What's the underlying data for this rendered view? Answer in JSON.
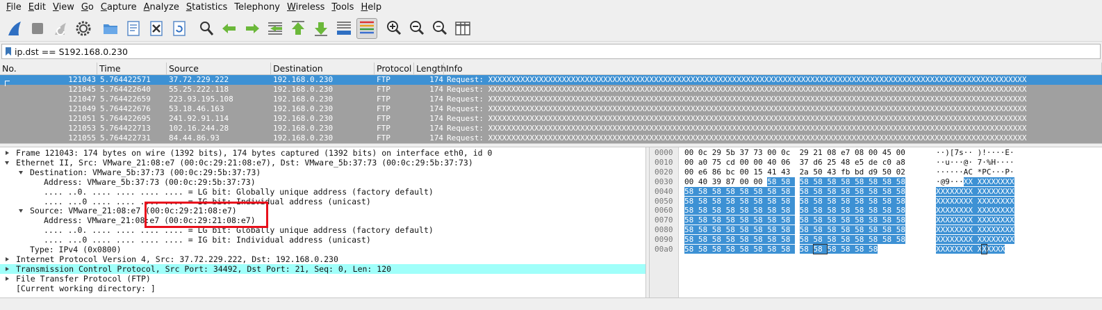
{
  "menu": [
    "File",
    "Edit",
    "View",
    "Go",
    "Capture",
    "Analyze",
    "Statistics",
    "Telephony",
    "Wireless",
    "Tools",
    "Help"
  ],
  "menu_underline": [
    "F",
    "E",
    "V",
    "G",
    "C",
    "A",
    "S",
    "",
    "W",
    "T",
    "H"
  ],
  "toolbar": {
    "icons": [
      "shark-fin-start-icon",
      "stop-capture-icon",
      "restart-capture-icon",
      "capture-options-gear-icon",
      "open-file-icon",
      "save-file-icon",
      "close-file-icon",
      "reload-file-icon",
      "find-packet-icon",
      "go-back-icon",
      "go-forward-icon",
      "go-to-packet-icon",
      "first-packet-icon",
      "last-packet-icon",
      "autoscroll-icon",
      "colorize-icon",
      "zoom-in-icon",
      "zoom-out-icon",
      "zoom-normal-icon",
      "resize-columns-icon"
    ]
  },
  "filter": {
    "value": "ip.dst == S192.168.0.230"
  },
  "packet_list": {
    "columns": [
      "No.",
      "Time",
      "Source",
      "Destination",
      "Protocol",
      "Length",
      "Info"
    ],
    "rows": [
      {
        "no": "121043",
        "time": "5.764422571",
        "src": "37.72.229.222",
        "dst": "192.168.0.230",
        "proto": "FTP",
        "len": "174",
        "info": "Request: XXXXXXXXXXXXXXXXXXXXXXXXXXXXXXXXXXXXXXXXXXXXXXXXXXXXXXXXXXXXXXXXXXXXXXXXXXXXXXXXXXXXXXXXXXXXXXXXXXXXXXXXXXXXXXXXXXXXX"
      },
      {
        "no": "121045",
        "time": "5.764422640",
        "src": "55.25.222.118",
        "dst": "192.168.0.230",
        "proto": "FTP",
        "len": "174",
        "info": "Request: XXXXXXXXXXXXXXXXXXXXXXXXXXXXXXXXXXXXXXXXXXXXXXXXXXXXXXXXXXXXXXXXXXXXXXXXXXXXXXXXXXXXXXXXXXXXXXXXXXXXXXXXXXXXXXXXXXXXX"
      },
      {
        "no": "121047",
        "time": "5.764422659",
        "src": "223.93.195.108",
        "dst": "192.168.0.230",
        "proto": "FTP",
        "len": "174",
        "info": "Request: XXXXXXXXXXXXXXXXXXXXXXXXXXXXXXXXXXXXXXXXXXXXXXXXXXXXXXXXXXXXXXXXXXXXXXXXXXXXXXXXXXXXXXXXXXXXXXXXXXXXXXXXXXXXXXXXXXXXX"
      },
      {
        "no": "121049",
        "time": "5.764422676",
        "src": "53.18.46.163",
        "dst": "192.168.0.230",
        "proto": "FTP",
        "len": "174",
        "info": "Request: XXXXXXXXXXXXXXXXXXXXXXXXXXXXXXXXXXXXXXXXXXXXXXXXXXXXXXXXXXXXXXXXXXXXXXXXXXXXXXXXXXXXXXXXXXXXXXXXXXXXXXXXXXXXXXXXXXXXX"
      },
      {
        "no": "121051",
        "time": "5.764422695",
        "src": "241.92.91.114",
        "dst": "192.168.0.230",
        "proto": "FTP",
        "len": "174",
        "info": "Request: XXXXXXXXXXXXXXXXXXXXXXXXXXXXXXXXXXXXXXXXXXXXXXXXXXXXXXXXXXXXXXXXXXXXXXXXXXXXXXXXXXXXXXXXXXXXXXXXXXXXXXXXXXXXXXXXXXXXX"
      },
      {
        "no": "121053",
        "time": "5.764422713",
        "src": "102.16.244.28",
        "dst": "192.168.0.230",
        "proto": "FTP",
        "len": "174",
        "info": "Request: XXXXXXXXXXXXXXXXXXXXXXXXXXXXXXXXXXXXXXXXXXXXXXXXXXXXXXXXXXXXXXXXXXXXXXXXXXXXXXXXXXXXXXXXXXXXXXXXXXXXXXXXXXXXXXXXXXXXX"
      },
      {
        "no": "121055",
        "time": "5.764422731",
        "src": "84.44.86.93",
        "dst": "192.168.0.230",
        "proto": "FTP",
        "len": "174",
        "info": "Request: XXXXXXXXXXXXXXXXXXXXXXXXXXXXXXXXXXXXXXXXXXXXXXXXXXXXXXXXXXXXXXXXXXXXXXXXXXXXXXXXXXXXXXXXXXXXXXXXXXXXXXXXXXXXXXXXXXXXX"
      }
    ]
  },
  "details": [
    {
      "text": "Frame 121043: 174 bytes on wire (1392 bits), 174 bytes captured (1392 bits) on interface eth0, id 0",
      "arrow": "closed"
    },
    {
      "text": "Ethernet II, Src: VMware_21:08:e7 (00:0c:29:21:08:e7), Dst: VMware_5b:37:73 (00:0c:29:5b:37:73)",
      "arrow": "open"
    },
    {
      "text": "Destination: VMware_5b:37:73 (00:0c:29:5b:37:73)",
      "arrow": "open"
    },
    {
      "text": "Address: VMware_5b:37:73 (00:0c:29:5b:37:73)",
      "arrow": ""
    },
    {
      "text": ".... ..0. .... .... .... .... = LG bit: Globally unique address (factory default)",
      "arrow": ""
    },
    {
      "text": ".... ...0 .... .... .... .... = IG bit: Individual address (unicast)",
      "arrow": ""
    },
    {
      "text": "Source: VMware_21:08:e7 (00:0c:29:21:08:e7)",
      "arrow": "open"
    },
    {
      "text": "Address: VMware_21:08:e7 (00:0c:29:21:08:e7)",
      "arrow": ""
    },
    {
      "text": ".... ..0. .... .... .... .... = LG bit: Globally unique address (factory default)",
      "arrow": ""
    },
    {
      "text": ".... ...0 .... .... .... .... = IG bit: Individual address (unicast)",
      "arrow": ""
    },
    {
      "text": "Type: IPv4 (0x0800)",
      "arrow": ""
    },
    {
      "text": "Internet Protocol Version 4, Src: 37.72.229.222, Dst: 192.168.0.230",
      "arrow": "closed"
    },
    {
      "text": "Transmission Control Protocol, Src Port: 34492, Dst Port: 21, Seq: 0, Len: 120",
      "arrow": "closed"
    },
    {
      "text": "File Transfer Protocol (FTP)",
      "arrow": "closed"
    },
    {
      "text": "[Current working directory: ]",
      "arrow": ""
    }
  ],
  "bytes": [
    {
      "off": "0000",
      "hex": "00 0c 29 5b 37 73 00 0c  29 21 08 e7 08 00 45 00",
      "asc": "··)[7s·· )!····E·"
    },
    {
      "off": "0010",
      "hex": "00 a0 75 cd 00 00 40 06  37 d6 25 48 e5 de c0 a8",
      "asc": "··u···@· 7·%H····"
    },
    {
      "off": "0020",
      "hex": "00 e6 86 bc 00 15 41 43  2a 50 43 fb bd d9 50 02",
      "asc": "······AC *PC···P·"
    },
    {
      "off": "0030",
      "hex": "00 40 39 87 00 00 58 58  58 58 58 58 58 58 58 58",
      "asc": "·@9···XX XXXXXXXX"
    },
    {
      "off": "0040",
      "hex": "58 58 58 58 58 58 58 58  58 58 58 58 58 58 58 58",
      "asc": "XXXXXXXX XXXXXXXX"
    },
    {
      "off": "0050",
      "hex": "58 58 58 58 58 58 58 58  58 58 58 58 58 58 58 58",
      "asc": "XXXXXXXX XXXXXXXX"
    },
    {
      "off": "0060",
      "hex": "58 58 58 58 58 58 58 58  58 58 58 58 58 58 58 58",
      "asc": "XXXXXXXX XXXXXXXX"
    },
    {
      "off": "0070",
      "hex": "58 58 58 58 58 58 58 58  58 58 58 58 58 58 58 58",
      "asc": "XXXXXXXX XXXXXXXX"
    },
    {
      "off": "0080",
      "hex": "58 58 58 58 58 58 58 58  58 58 58 58 58 58 58 58",
      "asc": "XXXXXXXX XXXXXXXX"
    },
    {
      "off": "0090",
      "hex": "58 58 58 58 58 58 58 58  58 58 58 58 58 58 58 58",
      "asc": "XXXXXXXX XXXXXXXX"
    },
    {
      "off": "00a0",
      "hex": "58 58 58 58 58 58 58 58  58 58 58 58 58 58",
      "asc": "XXXXXXXX XXXXXX"
    }
  ],
  "colors": {
    "selected_row": "#3d91d4",
    "list_bg": "#a0a0a0",
    "tcp_highlight": "#a0fffa",
    "annotation_box": "#e8101c"
  }
}
